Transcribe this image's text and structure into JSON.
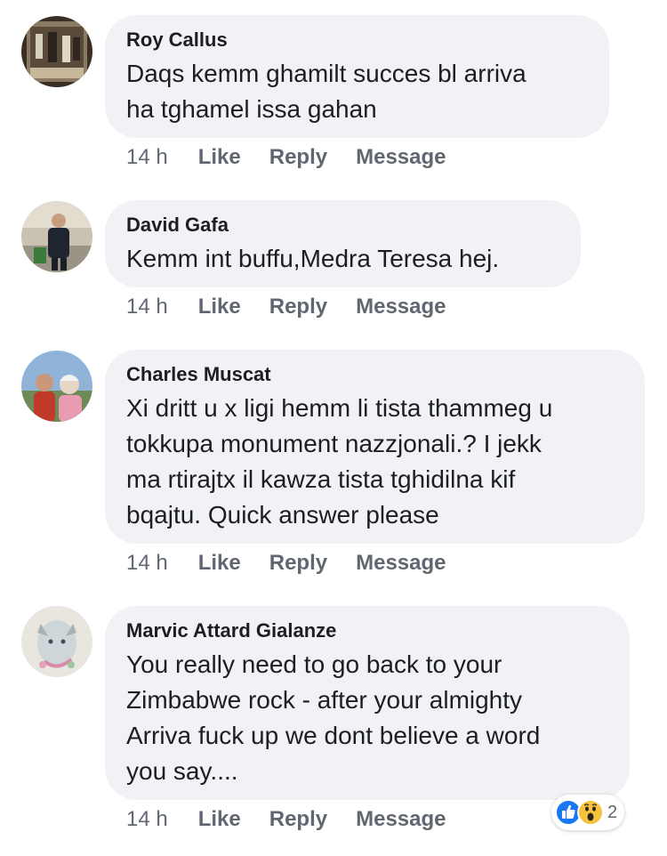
{
  "comments": [
    {
      "author": "Roy Callus",
      "text": "Daqs kemm ghamilt succes bl arriva\nha tghamel issa gahan",
      "time": "14 h",
      "like": "Like",
      "reply": "Reply",
      "message": "Message"
    },
    {
      "author": "David Gafa",
      "text": "Kemm int buffu,Medra Teresa hej.",
      "time": "14 h",
      "like": "Like",
      "reply": "Reply",
      "message": "Message"
    },
    {
      "author": "Charles Muscat",
      "text": "Xi dritt u x ligi hemm li tista thammeg u\ntokkupa monument nazzjonali.? I jekk\nma rtirajtx il kawza tista tghidilna kif\nbqajtu.  Quick answer please",
      "time": "14 h",
      "like": "Like",
      "reply": "Reply",
      "message": "Message"
    },
    {
      "author": "Marvic Attard Gialanze",
      "text": "You really need to go back to your\nZimbabwe rock  - after your almighty\nArriva fuck up we dont believe a word\nyou say....",
      "time": "14 h",
      "like": "Like",
      "reply": "Reply",
      "message": "Message",
      "reactions": {
        "icons": [
          "like-icon",
          "wow-icon"
        ],
        "count": "2"
      }
    }
  ],
  "colors": {
    "bubble": "#f0f2f5",
    "text": "#1c1e21",
    "meta": "#606770",
    "like_blue": "#1877f2",
    "wow_yellow": "#f7c33e"
  }
}
